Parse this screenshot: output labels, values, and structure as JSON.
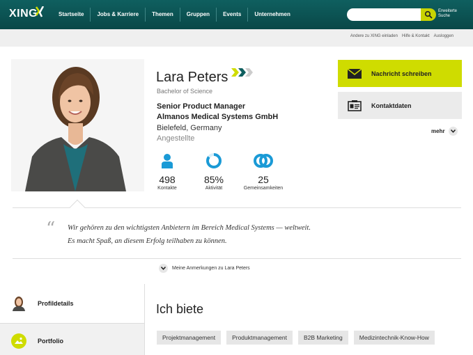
{
  "header": {
    "logo_text": "XING",
    "nav": [
      "Startseite",
      "Jobs & Karriere",
      "Themen",
      "Gruppen",
      "Events",
      "Unternehmen"
    ],
    "search_placeholder": "",
    "advanced_search": "Erweiterte Suche"
  },
  "meta_links": [
    "Andere zu XING einladen",
    "Hilfe & Kontakt",
    "Ausloggen"
  ],
  "profile": {
    "name": "Lara Peters",
    "degree": "Bachelor of Science",
    "position": "Senior Product Manager",
    "company": "Almanos Medical Systems GmbH",
    "location": "Bielefeld, Germany",
    "status": "Angestellte"
  },
  "stats": [
    {
      "value": "498",
      "label": "Kontakte",
      "icon": "person-icon"
    },
    {
      "value": "85%",
      "label": "Aktivität",
      "icon": "activity-ring-icon",
      "fraction": 0.85
    },
    {
      "value": "25",
      "label": "Gemeinsamkeiten",
      "icon": "overlap-rings-icon"
    }
  ],
  "actions": {
    "message": "Nachricht schreiben",
    "contact": "Kontaktdaten",
    "more": "mehr"
  },
  "quote": {
    "line1": "Wir gehören zu den wichtigsten Anbietern im Bereich Medical Systems — weltweit.",
    "line2": "Es macht Spaß, an diesem Erfolg teilhaben zu können."
  },
  "notes_label": "Meine Anmerkungen zu Lara Peters",
  "sidebar": [
    {
      "label": "Profildetails",
      "icon": "avatar-icon"
    },
    {
      "label": "Portfolio",
      "icon": "image-icon"
    }
  ],
  "offer": {
    "title": "Ich biete",
    "tags": [
      "Projektmanagement",
      "Produktmanagement",
      "B2B Marketing",
      "Medizintechnik-Know-How"
    ]
  },
  "colors": {
    "header": "#0f5f5f",
    "accent": "#cfdc00",
    "stat_icon": "#1a9ad6"
  }
}
